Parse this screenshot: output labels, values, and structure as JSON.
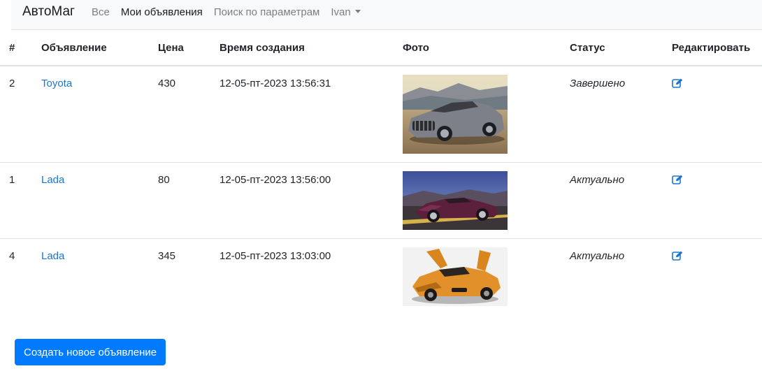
{
  "navbar": {
    "brand": "АвтоМаг",
    "links": [
      "Все",
      "Мои объявления",
      "Поиск по параметрам"
    ],
    "user": "Ivan"
  },
  "table": {
    "headers": [
      "#",
      "Объявление",
      "Цена",
      "Время создания",
      "Фото",
      "Статус",
      "Редактировать"
    ],
    "rows": [
      {
        "id": "2",
        "title": "Toyota",
        "price": "430",
        "created": "12-05-пт-2023 13:56:31",
        "status": "Завершено",
        "photo": "silver-convertible-car"
      },
      {
        "id": "1",
        "title": "Lada",
        "price": "80",
        "created": "12-05-пт-2023 13:56:00",
        "status": "Актуально",
        "photo": "purple-coupe-car"
      },
      {
        "id": "4",
        "title": "Lada",
        "price": "345",
        "created": "12-05-пт-2023 13:03:00",
        "status": "Актуально",
        "photo": "orange-sports-car"
      }
    ]
  },
  "create_button": "Создать новое объявление",
  "colors": {
    "link": "#1a75d2",
    "primary": "#007bff",
    "navbar_bg": "#f8f9fa"
  }
}
